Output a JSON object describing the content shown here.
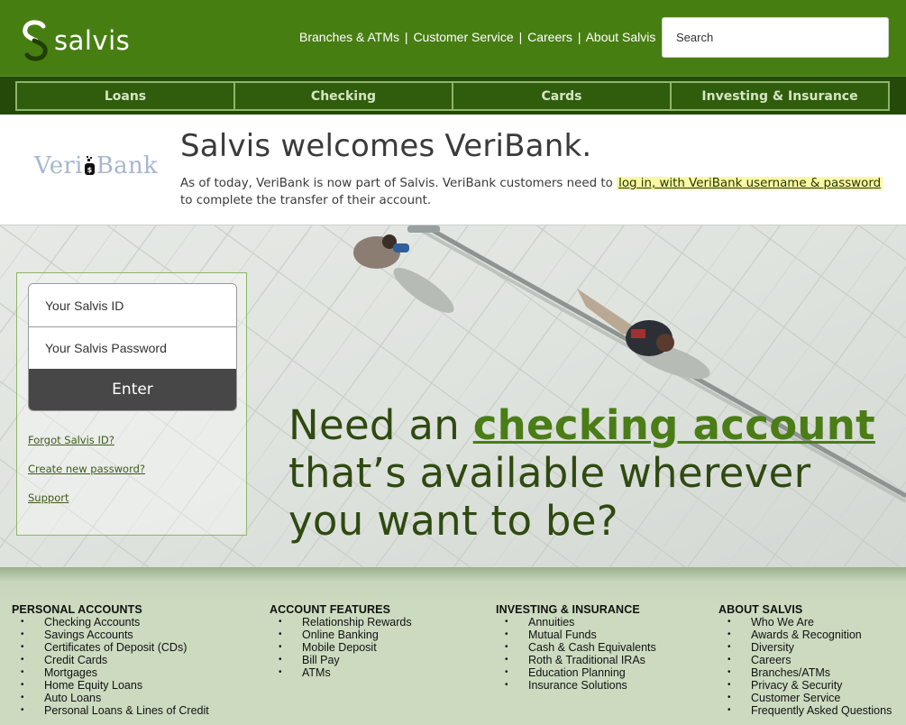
{
  "header": {
    "logo_text": "salvis",
    "links": [
      "Branches & ATMs",
      "Customer Service",
      "Careers",
      "About Salvis"
    ],
    "separator": "|",
    "search_placeholder": "Search"
  },
  "nav": {
    "tabs": [
      "Loans",
      "Checking",
      "Cards",
      "Investing & Insurance"
    ]
  },
  "welcome": {
    "partner_logo_left": "Veri",
    "partner_logo_right": "Bank",
    "title": "Salvis welcomes VeriBank.",
    "text_before": "As of today, VeriBank is now part of Salvis. VeriBank customers need to ",
    "link": "log in, with VeriBank username & password",
    "text_after": " to complete the transfer of their account."
  },
  "login": {
    "id_placeholder": "Your Salvis ID",
    "password_placeholder": "Your Salvis Password",
    "submit_label": "Enter",
    "links": [
      "Forgot Salvis ID?",
      "Create new password?",
      "Support"
    ]
  },
  "hero": {
    "tagline_1": "Need an ",
    "tagline_highlight": "checking account",
    "tagline_2": " that’s available wherever you want to be?"
  },
  "footer": {
    "columns": [
      {
        "title": "PERSONAL ACCOUNTS",
        "items": [
          "Checking Accounts",
          "Savings Accounts",
          "Certificates of Deposit (CDs)",
          "Credit Cards",
          "Mortgages",
          "Home Equity Loans",
          "Auto Loans",
          "Personal Loans & Lines of Credit"
        ]
      },
      {
        "title": "ACCOUNT FEATURES",
        "items": [
          "Relationship Rewards",
          "Online Banking",
          "Mobile Deposit",
          "Bill Pay",
          "ATMs"
        ]
      },
      {
        "title": "INVESTING & INSURANCE",
        "items": [
          "Annuities",
          "Mutual Funds",
          "Cash & Cash Equivalents",
          "Roth & Traditional IRAs",
          "Education Planning",
          "Insurance Solutions"
        ]
      },
      {
        "title": "ABOUT SALVIS",
        "items": [
          "Who We Are",
          "Awards & Recognition",
          "Diversity",
          "Careers",
          "Branches/ATMs",
          "Privacy & Security",
          "Customer Service",
          "Frequently Asked Questions"
        ]
      }
    ]
  },
  "colors": {
    "brand_green": "#477e12",
    "nav_dark": "#234a08",
    "highlight_link_bg": "#fbf7a8",
    "footer_bg": "#ccdbc0",
    "tagline_accent": "#4a7d16"
  }
}
